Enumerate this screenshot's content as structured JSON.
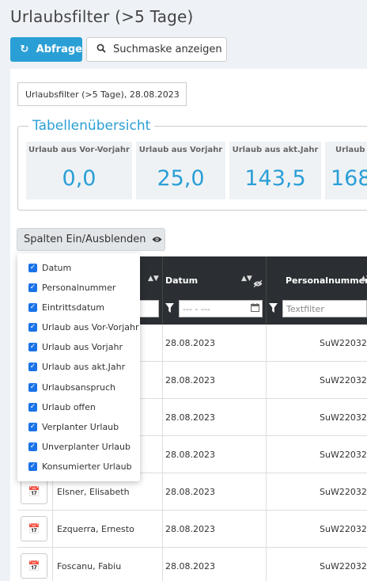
{
  "page": {
    "title": "Urlaubsfilter (>5 Tage)"
  },
  "toolbar": {
    "query_label": "Abfrage",
    "search_mask_label": "Suchmaske anzeigen"
  },
  "info": {
    "text": "Urlaubsfilter (>5 Tage), 28.08.2023"
  },
  "overview": {
    "legend": "Tabellenübersicht",
    "cards": [
      {
        "label": "Urlaub aus Vor-Vorjahr",
        "value": "0,0"
      },
      {
        "label": "Urlaub aus Vorjahr",
        "value": "25,0"
      },
      {
        "label": "Urlaub aus akt.Jahr",
        "value": "143,5"
      },
      {
        "label": "Urlaub o",
        "value": "168"
      }
    ]
  },
  "columns_toggle": {
    "label": "Spalten Ein/Ausblenden"
  },
  "column_menu": {
    "items": [
      "Datum",
      "Personalnummer",
      "Eintrittsdatum",
      "Urlaub aus Vor-Vorjahr",
      "Urlaub aus Vorjahr",
      "Urlaub aus akt.Jahr",
      "Urlaubsanspruch",
      "Urlaub offen",
      "Verplanter Urlaub",
      "Unverplanter Urlaub",
      "Konsumierter Urlaub"
    ]
  },
  "table": {
    "headers": {
      "datum": "Datum",
      "personalnummer": "Personalnummer"
    },
    "filters": {
      "date_placeholder": "--- - ---",
      "text_placeholder": "Textfilter"
    },
    "rows": [
      {
        "name": "",
        "datum": "28.08.2023",
        "personalnummer": "SuW22032"
      },
      {
        "name": "",
        "datum": "28.08.2023",
        "personalnummer": "SuW22032"
      },
      {
        "name": "",
        "datum": "28.08.2023",
        "personalnummer": "SuW22032"
      },
      {
        "name": "",
        "datum": "28.08.2023",
        "personalnummer": "SuW22032"
      },
      {
        "name": "Elsner, Elisabeth",
        "datum": "28.08.2023",
        "personalnummer": "SuW22032"
      },
      {
        "name": "Ezquerra, Ernesto",
        "datum": "28.08.2023",
        "personalnummer": "SuW22032"
      },
      {
        "name": "Foscanu, Fabiu",
        "datum": "28.08.2023",
        "personalnummer": "SuW22032"
      }
    ]
  },
  "colors": {
    "accent": "#2a9fd6",
    "table_header": "#2b2f33",
    "checkbox": "#1a73e8"
  }
}
